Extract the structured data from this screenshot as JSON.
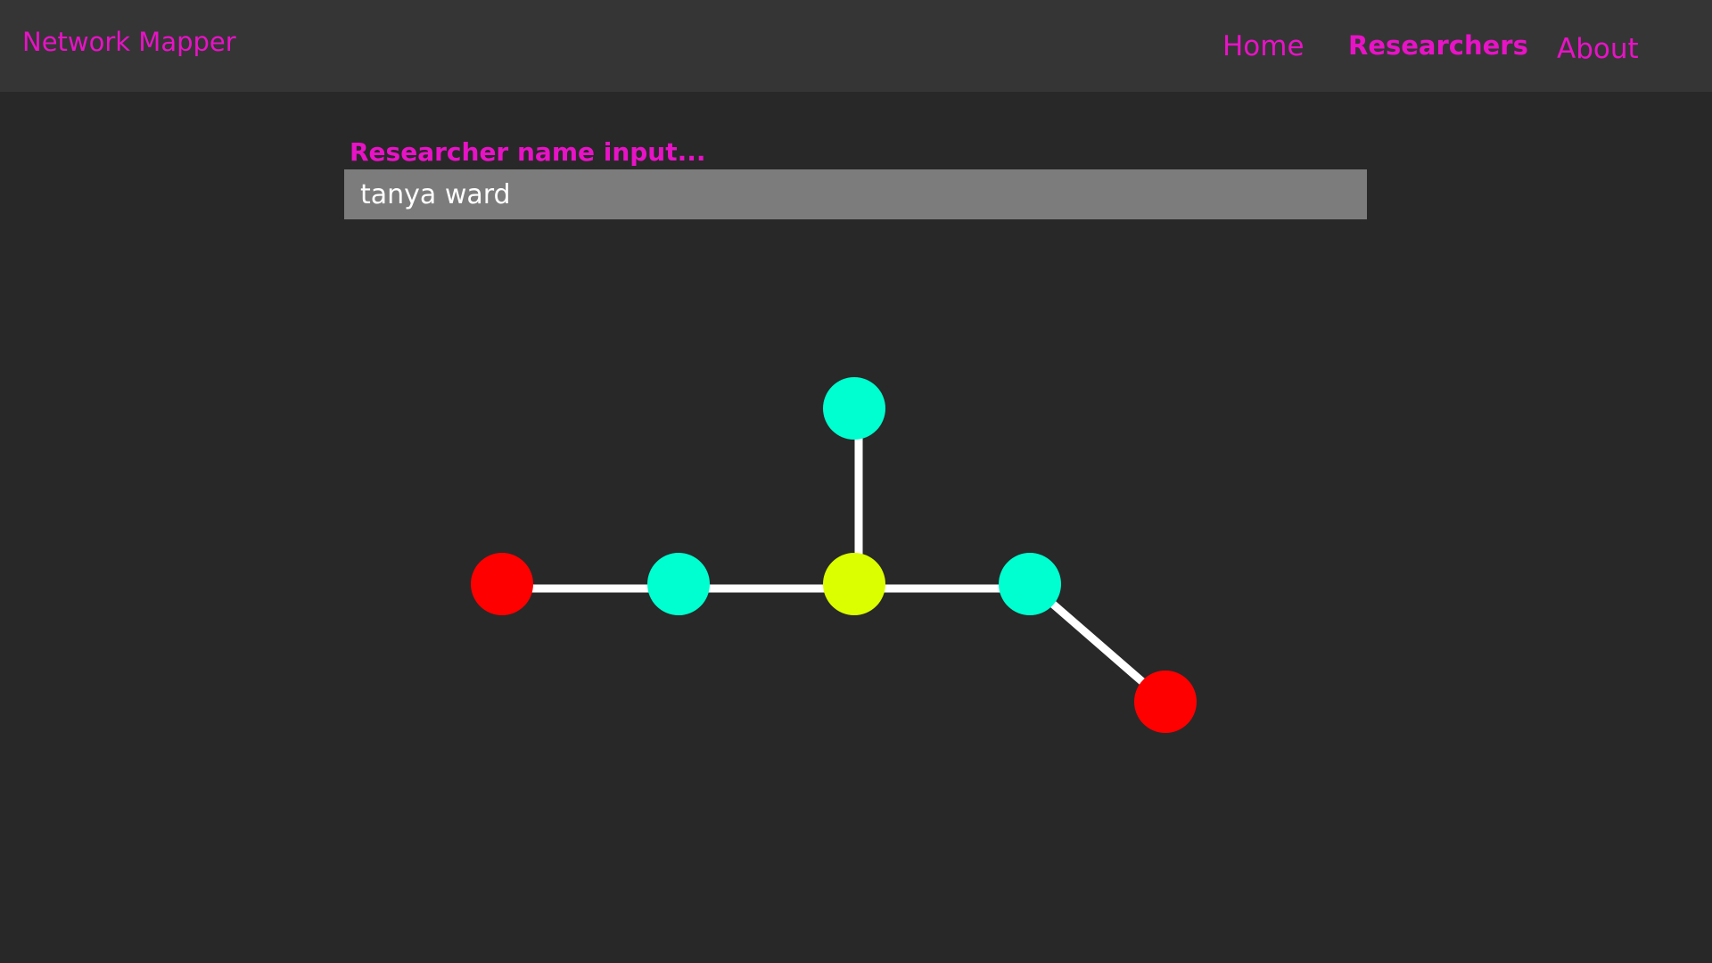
{
  "header": {
    "brand": "Network Mapper",
    "nav": [
      {
        "label": "Home",
        "active": false
      },
      {
        "label": "Researchers",
        "active": true
      },
      {
        "label": "About",
        "active": false
      }
    ]
  },
  "search": {
    "label": "Researcher name input...",
    "value": "tanya ward"
  },
  "colors": {
    "accent": "#e812c6",
    "background": "#282828",
    "header_background": "#353535",
    "input_background": "#7c7c7c",
    "edge": "#ffffff",
    "node_center": "#dcff00",
    "node_direct": "#00ffd0",
    "node_outer": "#ff0000"
  }
}
